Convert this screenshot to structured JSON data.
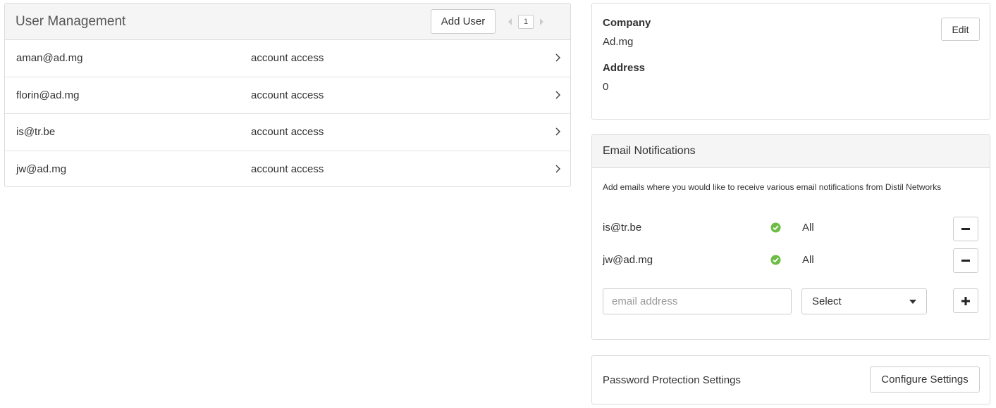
{
  "user_management": {
    "title": "User Management",
    "add_user_label": "Add User",
    "page_number": "1",
    "users": [
      {
        "email": "aman@ad.mg",
        "access": "account access"
      },
      {
        "email": "florin@ad.mg",
        "access": "account access"
      },
      {
        "email": "is@tr.be",
        "access": "account access"
      },
      {
        "email": "jw@ad.mg",
        "access": "account access"
      }
    ]
  },
  "company": {
    "company_label": "Company",
    "company_value": "Ad.mg",
    "address_label": "Address",
    "address_value": "0",
    "edit_label": "Edit"
  },
  "email_notifications": {
    "title": "Email Notifications",
    "description": "Add emails where you would like to receive various email notifications from Distil Networks",
    "recipients": [
      {
        "email": "is@tr.be",
        "type": "All"
      },
      {
        "email": "jw@ad.mg",
        "type": "All"
      }
    ],
    "email_placeholder": "email address",
    "select_value": "Select",
    "check_color": "#6cbd45"
  },
  "password": {
    "label": "Password Protection Settings",
    "configure_label": "Configure Settings"
  }
}
